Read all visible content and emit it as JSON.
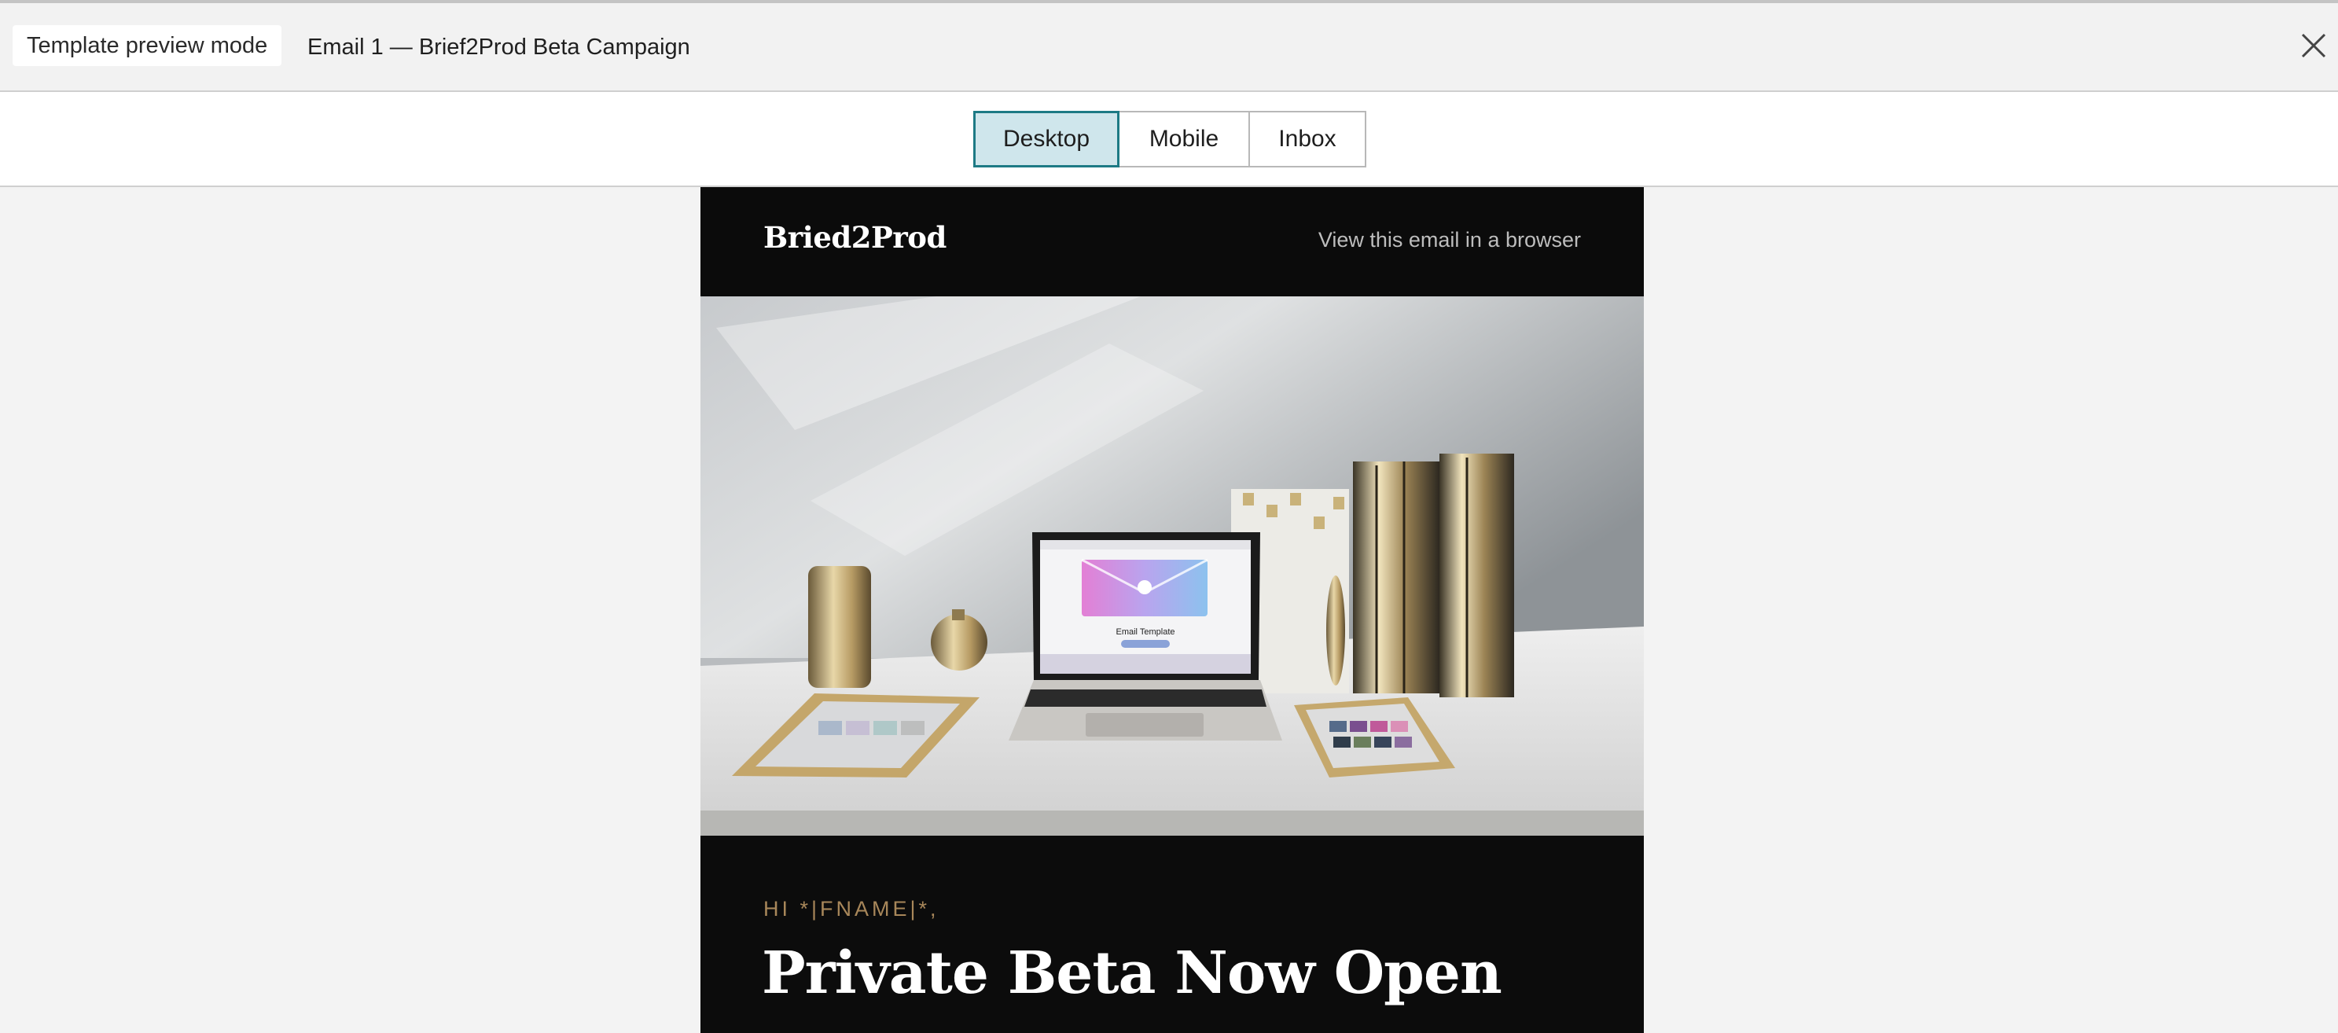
{
  "topbar": {
    "mode_label": "Template preview mode",
    "campaign_title": "Email 1 — Brief2Prod Beta Campaign",
    "close_icon": "close-icon"
  },
  "device_tabs": {
    "selected": "Desktop",
    "items": [
      {
        "label": "Desktop"
      },
      {
        "label": "Mobile"
      },
      {
        "label": "Inbox"
      }
    ]
  },
  "email": {
    "brand": "Bried2Prod",
    "view_in_browser": "View this email in a browser",
    "hero_template_caption": "Email Template",
    "greeting": "HI *|FNAME|*,",
    "headline": "Private Beta Now Open"
  },
  "colors": {
    "accent_tab_border": "#1d7a85",
    "accent_tab_fill": "#cfe6ec",
    "greeting_gold": "#a8875a",
    "email_background": "#0c0c0c"
  }
}
